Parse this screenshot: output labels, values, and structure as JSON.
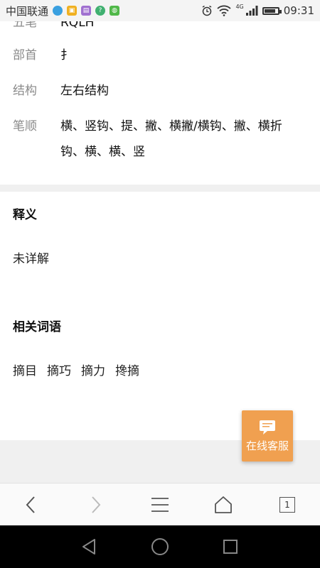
{
  "status_bar": {
    "carrier": "中国联通",
    "network_label": "4G",
    "time": "09:31",
    "battery_level": 0.85
  },
  "dictionary": {
    "rows": [
      {
        "label": "五笔",
        "value": "RQLH"
      },
      {
        "label": "部首",
        "value": "扌"
      },
      {
        "label": "结构",
        "value": "左右结构"
      },
      {
        "label": "笔顺",
        "value": "横、竖钩、提、撇、横撇/横钩、撇、横折钩、横、横、竖"
      }
    ],
    "meaning": {
      "title": "释义",
      "text": "未详解"
    },
    "related": {
      "title": "相关词语",
      "words": [
        "摘目",
        "摘巧",
        "摘力",
        "搀摘"
      ]
    }
  },
  "service_button": {
    "label": "在线客服",
    "color": "#f0a050"
  },
  "browser_toolbar": {
    "tab_count": "1"
  }
}
